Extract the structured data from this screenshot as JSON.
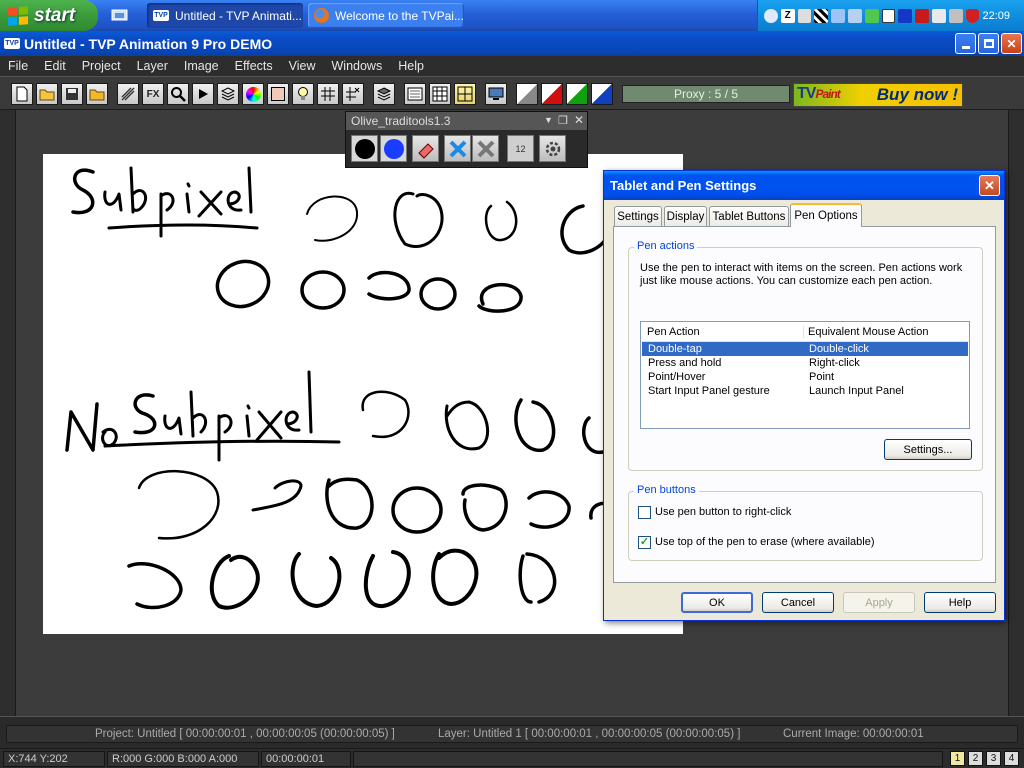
{
  "taskbar": {
    "start_label": "start",
    "tasks": [
      {
        "label": "Untitled - TVP Animati...",
        "active": true
      },
      {
        "label": "Welcome to the TVPai...",
        "active": false
      }
    ],
    "clock": "22:09"
  },
  "window": {
    "title": "Untitled - TVP Animation 9 Pro DEMO",
    "badge": "TVP"
  },
  "menu": [
    "File",
    "Edit",
    "Project",
    "Layer",
    "Image",
    "Effects",
    "View",
    "Windows",
    "Help"
  ],
  "toolbar": {
    "fx_label": "FX",
    "proxy": "Proxy : 5 / 5",
    "buy_now": "Buy now !",
    "logo_text": "TV",
    "logo_script": "Paint"
  },
  "olive_panel": {
    "title": "Olive_traditools1.3",
    "counter_label": "12"
  },
  "dialog": {
    "title": "Tablet and Pen Settings",
    "tabs": [
      "Settings",
      "Display",
      "Tablet Buttons",
      "Pen Options"
    ],
    "active_tab": "Pen Options",
    "pen_actions": {
      "legend": "Pen actions",
      "description": "Use the pen to interact with items on the screen. Pen actions work just like mouse actions. You can customize each pen action.",
      "columns": [
        "Pen Action",
        "Equivalent Mouse Action"
      ],
      "rows": [
        {
          "action": "Double-tap",
          "mouse": "Double-click",
          "selected": true
        },
        {
          "action": "Press and hold",
          "mouse": "Right-click",
          "selected": false
        },
        {
          "action": "Point/Hover",
          "mouse": "Point",
          "selected": false
        },
        {
          "action": "Start Input Panel gesture",
          "mouse": "Launch Input Panel",
          "selected": false
        }
      ],
      "settings_button": "Settings..."
    },
    "pen_buttons": {
      "legend": "Pen buttons",
      "right_click_label": "Use pen button to right-click",
      "right_click_checked": false,
      "erase_label": "Use top of the pen to erase (where available)",
      "erase_checked": true
    },
    "buttons": {
      "ok": "OK",
      "cancel": "Cancel",
      "apply": "Apply",
      "help": "Help"
    }
  },
  "status": {
    "project": "Project: Untitled [ 00:00:00:01 , 00:00:00:05  (00:00:00:05) ]",
    "layer": "Layer: Untitled 1 [ 00:00:00:01 , 00:00:00:05  (00:00:00:05) ]",
    "current_image": "Current Image: 00:00:00:01",
    "coords": "X:744  Y:202",
    "rgba": "R:000 G:000 B:000 A:000",
    "time": "00:00:00:01",
    "pages": [
      "1",
      "2",
      "3",
      "4"
    ],
    "active_page": "1"
  }
}
